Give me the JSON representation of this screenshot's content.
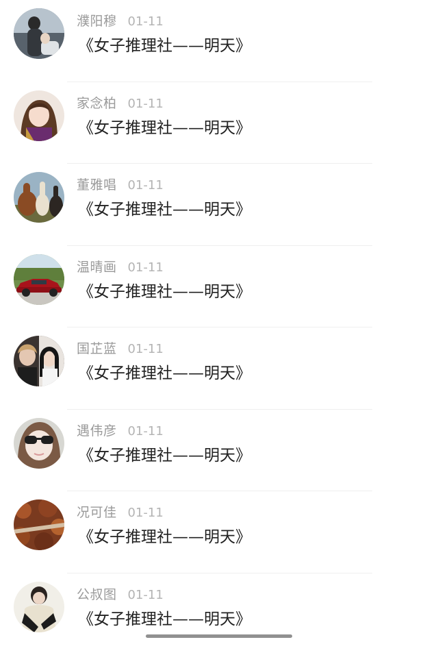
{
  "comments": [
    {
      "name": "濮阳穆",
      "date": "01-11",
      "text": "《女子推理社——明天》",
      "avatar": "man-beach-avatar"
    },
    {
      "name": "家念柏",
      "date": "01-11",
      "text": "《女子推理社——明天》",
      "avatar": "woman-portrait-avatar"
    },
    {
      "name": "董雅唱",
      "date": "01-11",
      "text": "《女子推理社——明天》",
      "avatar": "alpacas-avatar"
    },
    {
      "name": "温晴画",
      "date": "01-11",
      "text": "《女子推理社——明天》",
      "avatar": "red-car-avatar"
    },
    {
      "name": "国芷蓝",
      "date": "01-11",
      "text": "《女子推理社——明天》",
      "avatar": "couple-avatar"
    },
    {
      "name": "遇伟彦",
      "date": "01-11",
      "text": "《女子推理社——明天》",
      "avatar": "sunglasses-avatar"
    },
    {
      "name": "况可佳",
      "date": "01-11",
      "text": "《女子推理社——明天》",
      "avatar": "autumn-road-avatar"
    },
    {
      "name": "公叔图",
      "date": "01-11",
      "text": "《女子推理社——明天》",
      "avatar": "person-avatar"
    }
  ],
  "colors": {
    "name": "#9a9a9a",
    "date": "#b4b4b4",
    "message": "#222222",
    "divider": "#efefef",
    "home_indicator": "#909090"
  }
}
